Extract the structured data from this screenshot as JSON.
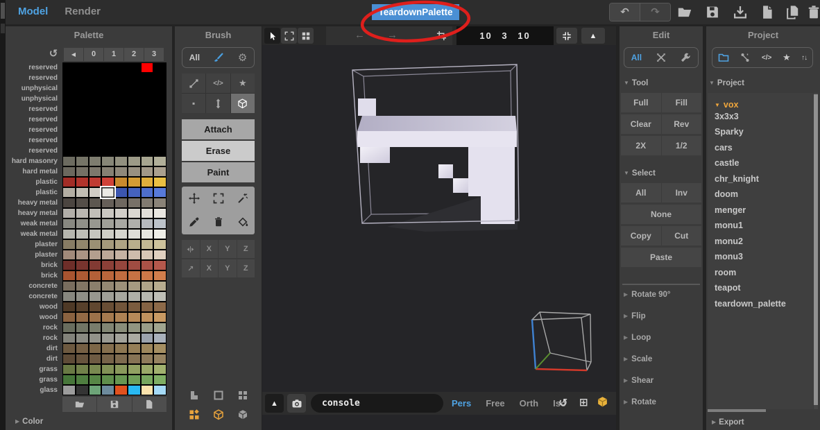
{
  "topbar": {
    "tabs": [
      {
        "label": "Model",
        "active": true
      },
      {
        "label": "Render",
        "active": false
      }
    ],
    "title": "TeardownPalette"
  },
  "icons": {
    "undo": "↶",
    "redo": "↷",
    "refresh": "↺",
    "prev_tab": "◀",
    "gear": "⚙",
    "star": "★",
    "code": "</>",
    "small_square": "▪",
    "diag_arrow": "↗",
    "arrow_left": "←",
    "arrow_right": "→",
    "triangle_up": "▲",
    "rotate_ccw": "↺",
    "layout_grid": "⊞",
    "sort_updown": "↑↓",
    "collapse_down": "▼",
    "collapse_right": "▶"
  },
  "palette": {
    "title": "Palette",
    "nav_tabs": [
      "◀",
      "0",
      "1",
      "2",
      "3"
    ],
    "selected": {
      "row": 12,
      "col": 3
    },
    "footer_section": "Color",
    "rows": [
      {
        "label": "reserved",
        "colors": [
          "#000000",
          "#000000",
          "#000000",
          "#000000",
          "#000000",
          "#000000",
          "#ff0000",
          "#000000"
        ]
      },
      {
        "label": "reserved",
        "colors": [
          "#000000",
          "#000000",
          "#000000",
          "#000000",
          "#000000",
          "#000000",
          "#000000",
          "#000000"
        ]
      },
      {
        "label": "unphysical",
        "colors": [
          "#000000",
          "#000000",
          "#000000",
          "#000000",
          "#000000",
          "#000000",
          "#000000",
          "#000000"
        ]
      },
      {
        "label": "unphysical",
        "colors": [
          "#000000",
          "#000000",
          "#000000",
          "#000000",
          "#000000",
          "#000000",
          "#000000",
          "#000000"
        ]
      },
      {
        "label": "reserved",
        "colors": [
          "#000000",
          "#000000",
          "#000000",
          "#000000",
          "#000000",
          "#000000",
          "#000000",
          "#000000"
        ]
      },
      {
        "label": "reserved",
        "colors": [
          "#000000",
          "#000000",
          "#000000",
          "#000000",
          "#000000",
          "#000000",
          "#000000",
          "#000000"
        ]
      },
      {
        "label": "reserved",
        "colors": [
          "#000000",
          "#000000",
          "#000000",
          "#000000",
          "#000000",
          "#000000",
          "#000000",
          "#000000"
        ]
      },
      {
        "label": "reserved",
        "colors": [
          "#000000",
          "#000000",
          "#000000",
          "#000000",
          "#000000",
          "#000000",
          "#000000",
          "#000000"
        ]
      },
      {
        "label": "reserved",
        "colors": [
          "#000000",
          "#000000",
          "#000000",
          "#000000",
          "#000000",
          "#000000",
          "#000000",
          "#000000"
        ]
      },
      {
        "label": "hard masonry",
        "colors": [
          "#6c6b60",
          "#757467",
          "#7e7d6f",
          "#878677",
          "#92907f",
          "#9c9a87",
          "#a7a590",
          "#b1af99"
        ]
      },
      {
        "label": "hard metal",
        "colors": [
          "#6b685e",
          "#747065",
          "#7d786c",
          "#868073",
          "#8f887a",
          "#989081",
          "#a19888",
          "#aaa08f"
        ]
      },
      {
        "label": "plastic",
        "colors": [
          "#a22d26",
          "#b1342c",
          "#c03b32",
          "#d04238",
          "#c98a2e",
          "#d49c35",
          "#dfae3c",
          "#eac043"
        ]
      },
      {
        "label": "plastic",
        "colors": [
          "#b3aea3",
          "#c2beb4",
          "#d1cdc5",
          "#eceae5",
          "#3c56b0",
          "#4562be",
          "#4e6ecc",
          "#577ada"
        ]
      },
      {
        "label": "heavy metal",
        "colors": [
          "#4b4540",
          "#544e48",
          "#5d5750",
          "#665f58",
          "#6f6860",
          "#787168",
          "#817a70",
          "#8a8378"
        ]
      },
      {
        "label": "heavy metal",
        "colors": [
          "#b2afa9",
          "#bab7b1",
          "#c2bfb9",
          "#cac7c1",
          "#d2cfc9",
          "#dad7d1",
          "#e2dfd9",
          "#eae7e1"
        ]
      },
      {
        "label": "weak metal",
        "colors": [
          "#888880",
          "#909088",
          "#989890",
          "#a0a098",
          "#a8a8a2",
          "#b0b0ac",
          "#b6b9bd",
          "#bcc2c9"
        ]
      },
      {
        "label": "weak metal",
        "colors": [
          "#b6b6ae",
          "#bebeb6",
          "#c6c6be",
          "#cecec6",
          "#d6d6cf",
          "#deded8",
          "#e6e6e0",
          "#eeeee8"
        ]
      },
      {
        "label": "plaster",
        "colors": [
          "#877c64",
          "#91866c",
          "#9b9074",
          "#a59a7c",
          "#afa484",
          "#b9ae8c",
          "#c3b894",
          "#cdc29c"
        ]
      },
      {
        "label": "plaster",
        "colors": [
          "#a18a7a",
          "#aa9484",
          "#b39e8e",
          "#bca898",
          "#c5b2a2",
          "#cebcac",
          "#d7c6b6",
          "#e0d0c0"
        ]
      },
      {
        "label": "brick",
        "colors": [
          "#6e2e29",
          "#78342e",
          "#823a33",
          "#8c4038",
          "#96463d",
          "#a04c42",
          "#aa5247",
          "#b4584c"
        ]
      },
      {
        "label": "brick",
        "colors": [
          "#a85430",
          "#ae5a34",
          "#b46038",
          "#ba663c",
          "#c06c40",
          "#c67244",
          "#cc7848",
          "#d27e4c"
        ]
      },
      {
        "label": "concrete",
        "colors": [
          "#796d5e",
          "#827665",
          "#8b7f6c",
          "#948873",
          "#9d917a",
          "#a69a81",
          "#afa388",
          "#b8ac8f"
        ]
      },
      {
        "label": "concrete",
        "colors": [
          "#87877f",
          "#8f8f87",
          "#97978f",
          "#9f9f97",
          "#a7a79f",
          "#afafa7",
          "#b7b7af",
          "#bfbfb7"
        ]
      },
      {
        "label": "wood",
        "colors": [
          "#4e3926",
          "#57402b",
          "#604730",
          "#694e35",
          "#72553a",
          "#7b5c3f",
          "#846344",
          "#8d6a49"
        ]
      },
      {
        "label": "wood",
        "colors": [
          "#8a6240",
          "#936a45",
          "#9c724a",
          "#a57a4f",
          "#ae8254",
          "#b78a59",
          "#c0925e",
          "#c99a63"
        ]
      },
      {
        "label": "rock",
        "colors": [
          "#696d5e",
          "#717565",
          "#797d6c",
          "#818573",
          "#898d7a",
          "#919581",
          "#999d88",
          "#a1a58f"
        ]
      },
      {
        "label": "rock",
        "colors": [
          "#82827a",
          "#8a8a82",
          "#92928a",
          "#9a9a92",
          "#a2a29a",
          "#aaaaa2",
          "#9ba3ad",
          "#a9b1bb"
        ]
      },
      {
        "label": "dirt",
        "colors": [
          "#6d5940",
          "#755f44",
          "#7d6748",
          "#856f4e",
          "#8d7752",
          "#957f58",
          "#9d875c",
          "#a58f62"
        ]
      },
      {
        "label": "dirt",
        "colors": [
          "#5e4b37",
          "#66533d",
          "#6e5b43",
          "#766349",
          "#7e6b4f",
          "#867355",
          "#8e7b5b",
          "#968361"
        ]
      },
      {
        "label": "grass",
        "colors": [
          "#697944",
          "#71814a",
          "#798950",
          "#819156",
          "#89995c",
          "#91a162",
          "#99a968",
          "#a1b16e"
        ]
      },
      {
        "label": "grass",
        "colors": [
          "#47763a",
          "#4f7e40",
          "#578646",
          "#5f8e4c",
          "#679652",
          "#6f9e58",
          "#77a65e",
          "#7fae64"
        ]
      },
      {
        "label": "glass",
        "colors": [
          "#9c9c9c",
          "#343434",
          "#6da478",
          "#6d8b9d",
          "#e1511e",
          "#29b9f2",
          "#fbe3ad",
          "#a5daf7"
        ]
      }
    ]
  },
  "brush": {
    "title": "Brush",
    "filter_all": "All",
    "modes": [
      "Attach",
      "Erase",
      "Paint"
    ],
    "active_mode": "Erase",
    "mirror_axes": [
      "X",
      "Y",
      "Z"
    ],
    "loop_axes": [
      "X",
      "Y",
      "Z"
    ]
  },
  "viewport": {
    "dimensions": "10 3 10",
    "console_placeholder": "console",
    "view_modes": [
      {
        "label": "Pers",
        "active": true
      },
      {
        "label": "Free",
        "active": false
      },
      {
        "label": "Orth",
        "active": false
      },
      {
        "label": "Iso",
        "active": false
      }
    ]
  },
  "edit": {
    "title": "Edit",
    "filter_all": "All",
    "tool_section": "Tool",
    "tool_buttons": [
      [
        "Full",
        "Fill"
      ],
      [
        "Clear",
        "Rev"
      ],
      [
        "2X",
        "1/2"
      ]
    ],
    "select_section": "Select",
    "select_buttons": [
      [
        "All",
        "Inv"
      ],
      [
        "None"
      ],
      [
        "Copy",
        "Cut"
      ],
      [
        "Paste"
      ]
    ],
    "collapsed_sections": [
      "Rotate 90°",
      "Flip",
      "Loop",
      "Scale",
      "Shear",
      "Rotate"
    ]
  },
  "project": {
    "title": "Project",
    "section": "Project",
    "root": "vox",
    "items": [
      "3x3x3",
      "Sparky",
      "cars",
      "castle",
      "chr_knight",
      "doom",
      "menger",
      "monu1",
      "monu2",
      "monu3",
      "room",
      "teapot",
      "teardown_palette"
    ],
    "export_section": "Export"
  },
  "colors": {
    "accent_blue": "#4fa3e3",
    "vox_orange": "#efa63c",
    "annotation_red": "#de1f1c",
    "selected_swatch_red": "#ff0000"
  }
}
